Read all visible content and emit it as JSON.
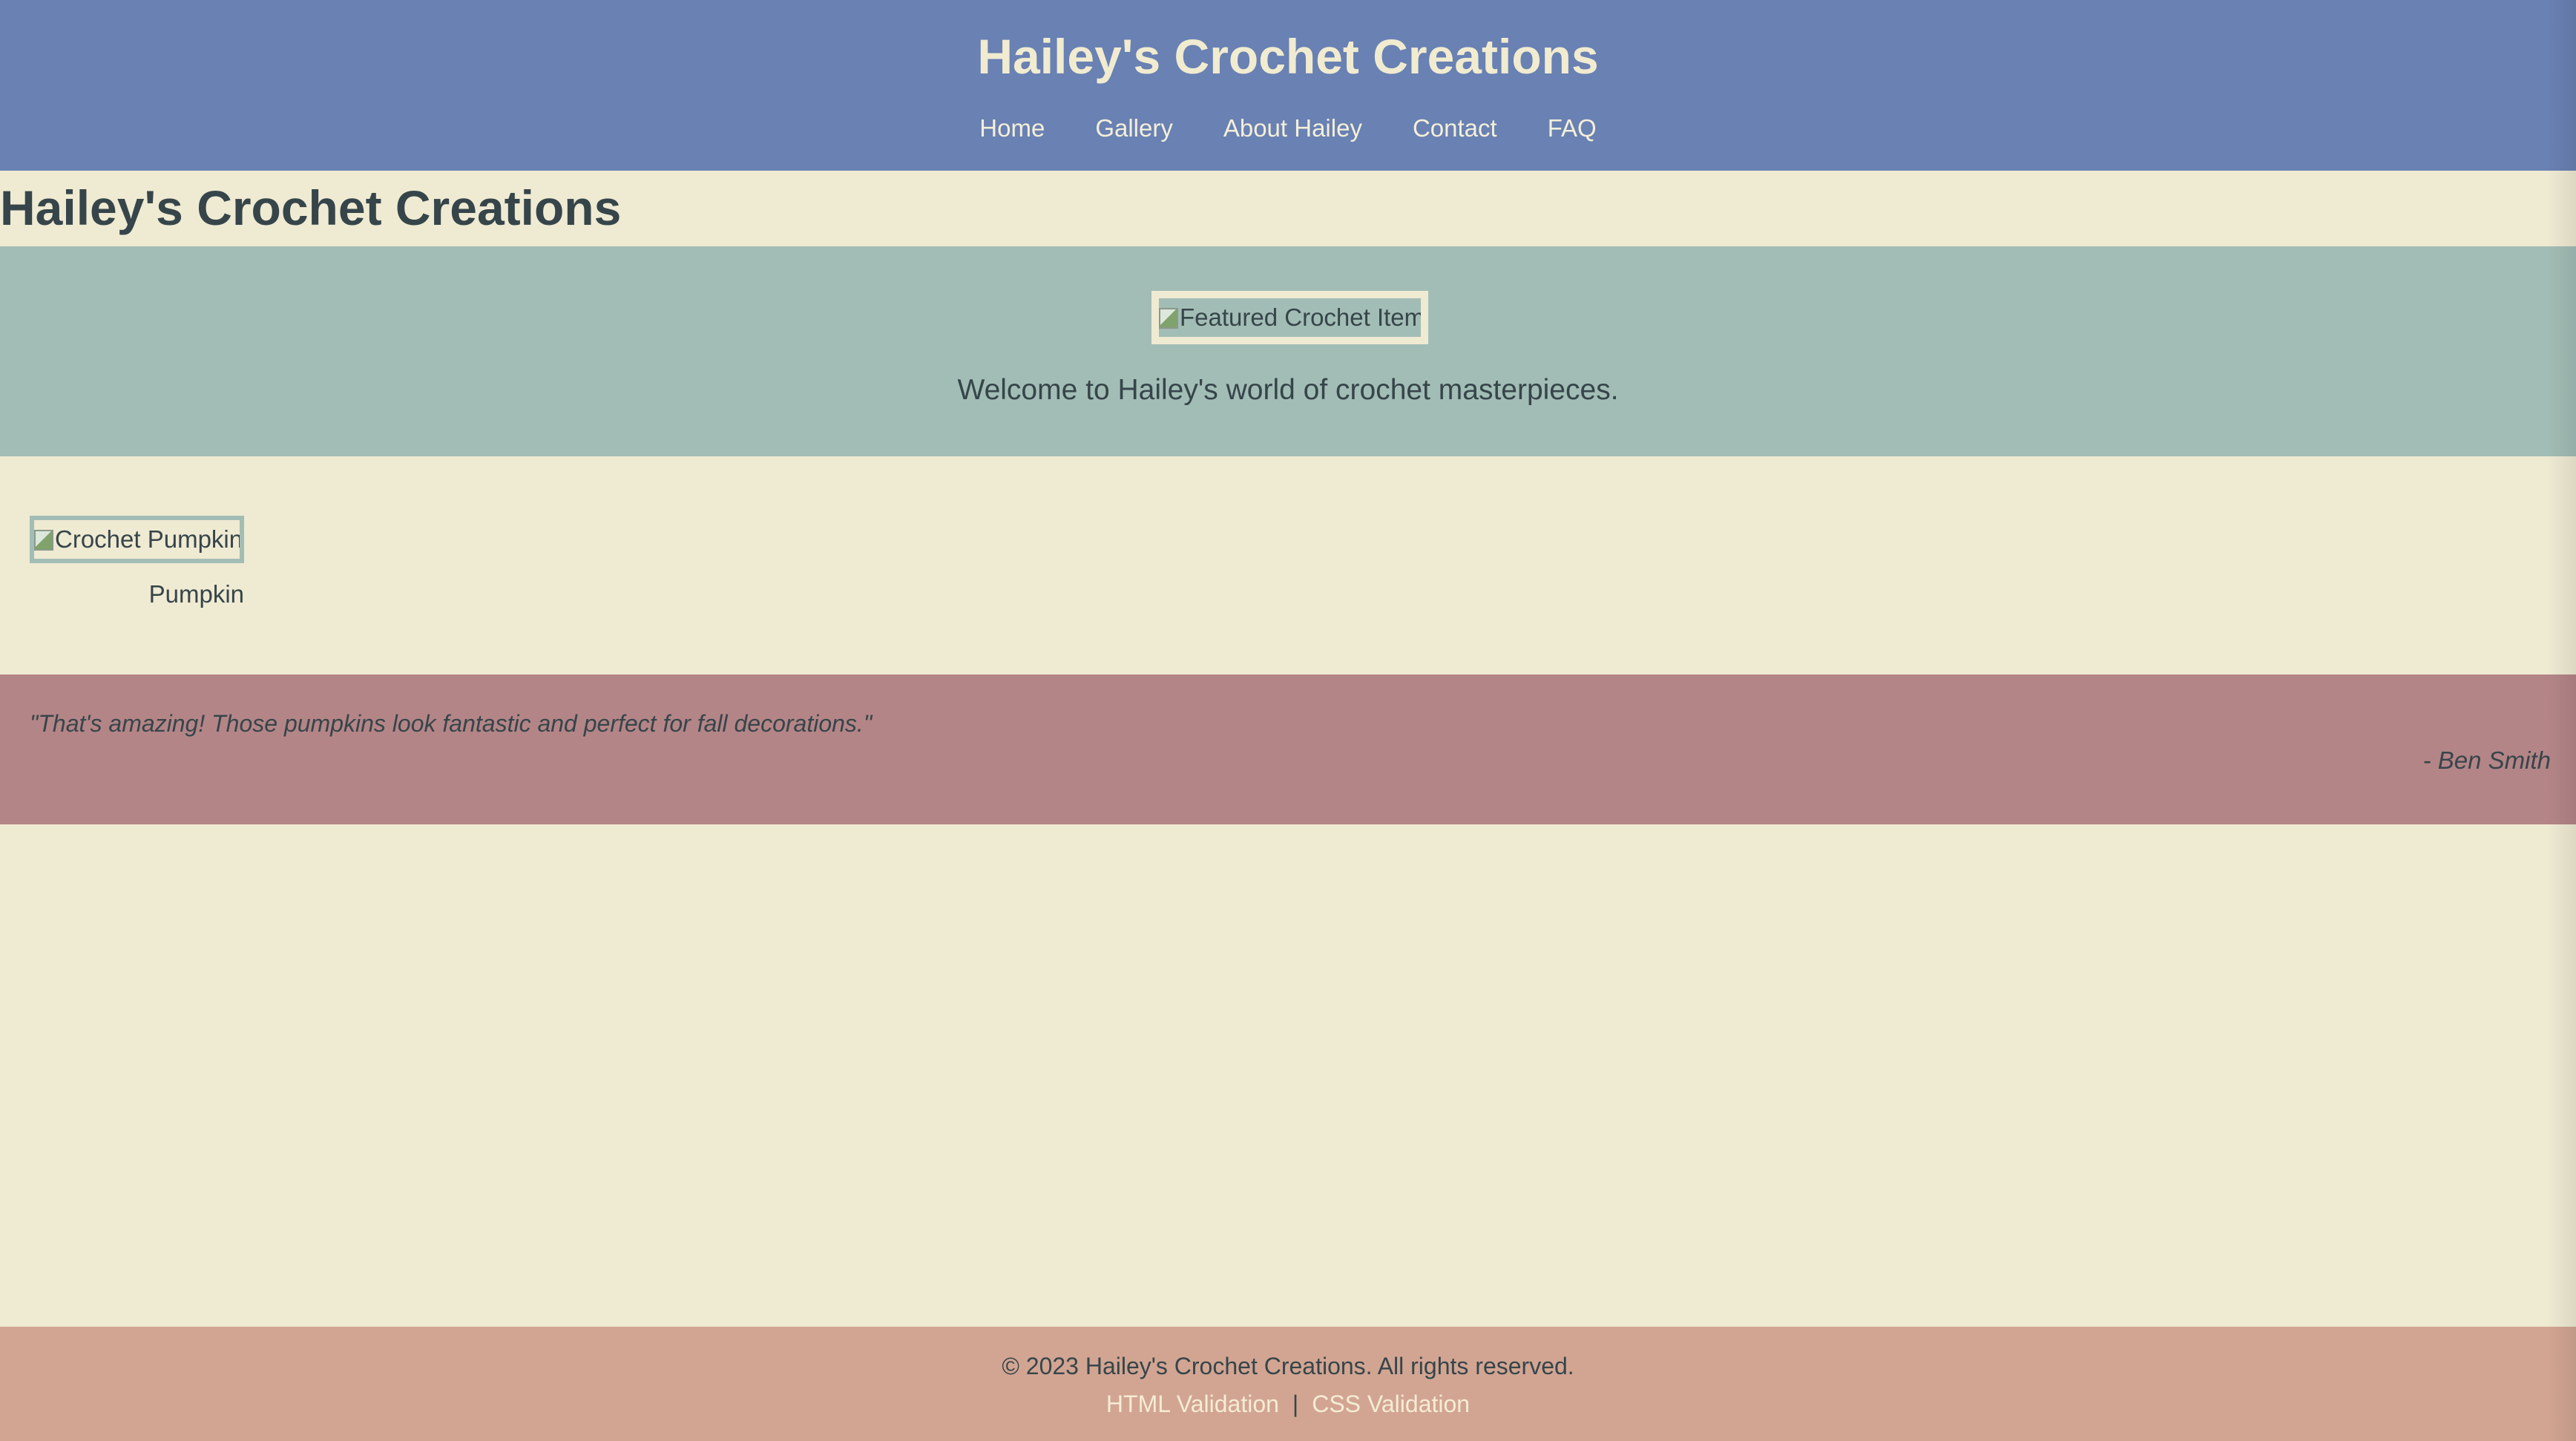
{
  "header": {
    "title": "Hailey's Crochet Creations",
    "nav": [
      "Home",
      "Gallery",
      "About Hailey",
      "Contact",
      "FAQ"
    ]
  },
  "main": {
    "heading": "Hailey's Crochet Creations",
    "hero": {
      "featured_alt": "Featured Crochet Item",
      "welcome": "Welcome to Hailey's world of crochet masterpieces."
    },
    "gallery": [
      {
        "alt": "Crochet Pumpkin",
        "caption": "Pumpkin"
      }
    ],
    "testimonial": {
      "quote": "\"That's amazing! Those pumpkins look fantastic and perfect for fall decorations.\"",
      "author": "- Ben Smith"
    }
  },
  "footer": {
    "copyright": "© 2023 Hailey's Crochet Creations. All rights reserved.",
    "links": [
      "HTML Validation",
      "CSS Validation"
    ],
    "separator": "|"
  },
  "colors": {
    "header_bg": "#6981b3",
    "page_bg": "#efead2",
    "hero_bg": "#a2bdb5",
    "testimonial_bg": "#b48587",
    "footer_bg": "#d2a592",
    "text": "#36454a"
  }
}
